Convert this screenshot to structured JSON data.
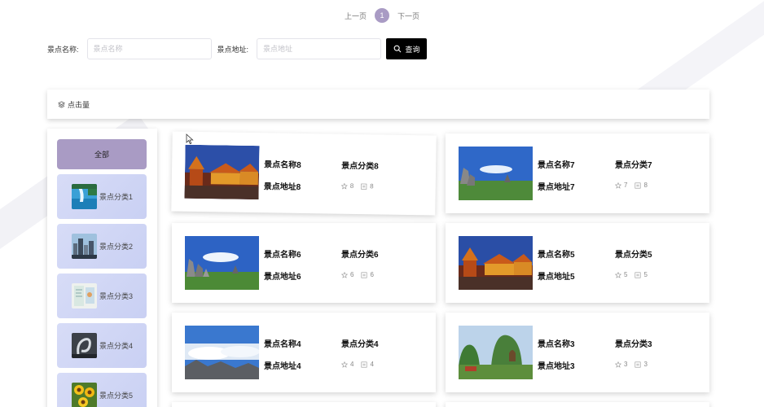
{
  "pagination": {
    "prev": "上一页",
    "current": "1",
    "next": "下一页"
  },
  "search": {
    "name_label": "景点名称:",
    "name_placeholder": "景点名称",
    "name_value": "",
    "address_label": "景点地址:",
    "address_placeholder": "景点地址",
    "address_value": "",
    "button_label": "查询"
  },
  "sort": {
    "label": "点击量"
  },
  "sidebar": {
    "all_label": "全部",
    "categories": [
      {
        "label": "景点分类1",
        "thumb": "waterfall"
      },
      {
        "label": "景点分类2",
        "thumb": "city"
      },
      {
        "label": "景点分类3",
        "thumb": "map"
      },
      {
        "label": "景点分类4",
        "thumb": "sculpture"
      },
      {
        "label": "景点分类5",
        "thumb": "sunflower"
      }
    ]
  },
  "spots": [
    {
      "name": "景点名称8",
      "category": "景点分类8",
      "address": "景点地址8",
      "stars": "8",
      "comments": "8",
      "photo": "temple"
    },
    {
      "name": "景点名称7",
      "category": "景点分类7",
      "address": "景点地址7",
      "stars": "7",
      "comments": "8",
      "photo": "stoneforest"
    },
    {
      "name": "景点名称6",
      "category": "景点分类6",
      "address": "景点地址6",
      "stars": "6",
      "comments": "6",
      "photo": "stoneforest"
    },
    {
      "name": "景点名称5",
      "category": "景点分类5",
      "address": "景点地址5",
      "stars": "5",
      "comments": "5",
      "photo": "temple"
    },
    {
      "name": "景点名称4",
      "category": "景点分类4",
      "address": "景点地址4",
      "stars": "4",
      "comments": "4",
      "photo": "clouds"
    },
    {
      "name": "景点名称3",
      "category": "景点分类3",
      "address": "景点地址3",
      "stars": "3",
      "comments": "3",
      "photo": "karst"
    }
  ],
  "colors": {
    "accent": "#a99bc4",
    "category_bg": "#d0d6f5",
    "button": "#000000"
  }
}
